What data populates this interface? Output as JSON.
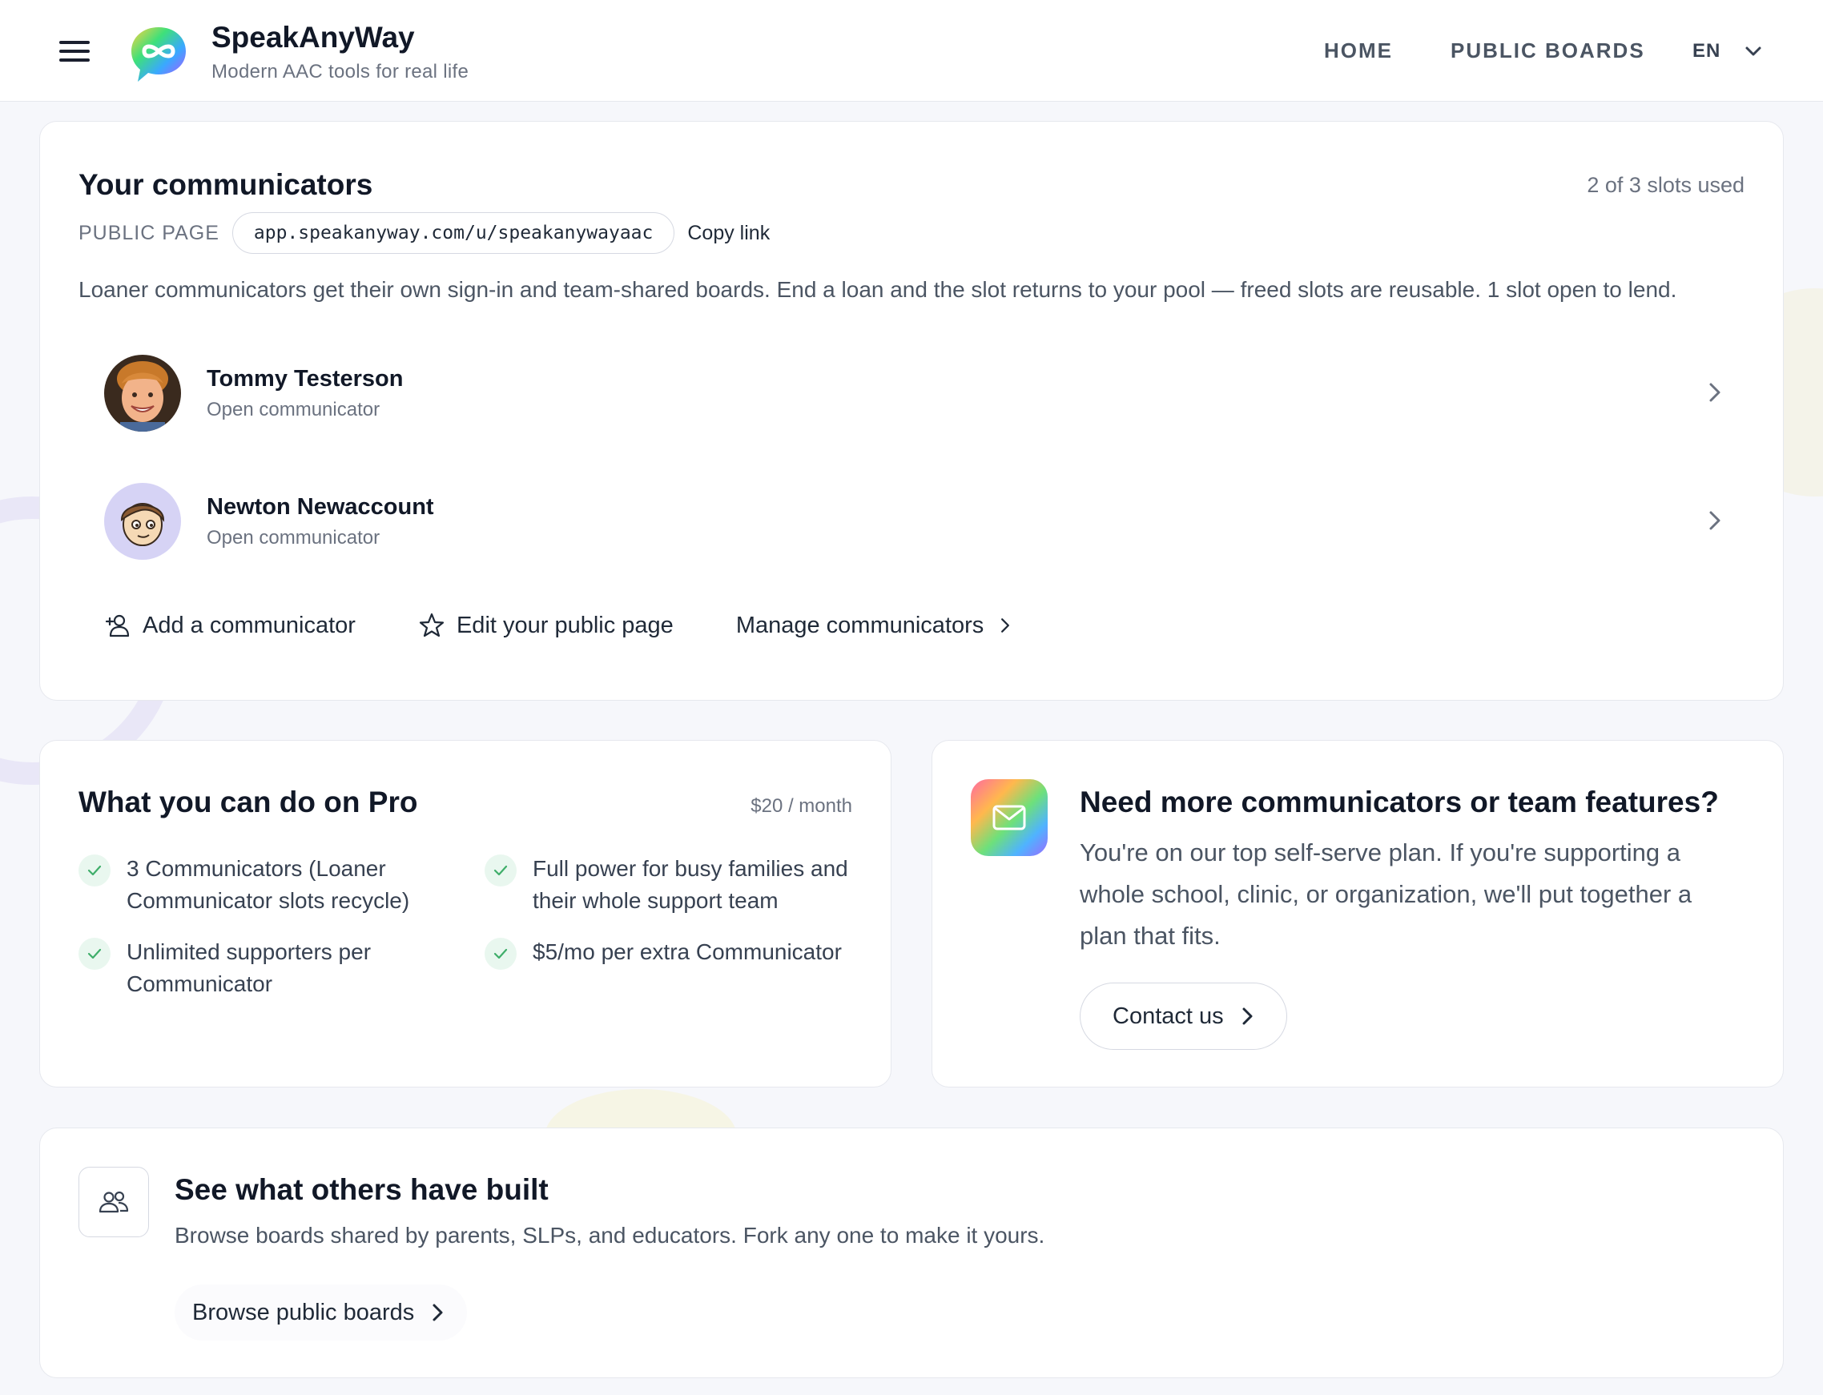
{
  "header": {
    "brand_name": "SpeakAnyWay",
    "brand_tagline": "Modern AAC tools for real life",
    "nav": {
      "home": "HOME",
      "public_boards": "PUBLIC BOARDS"
    },
    "language": "EN"
  },
  "communicators": {
    "title": "Your communicators",
    "slots_used": "2 of 3 slots used",
    "public_page_label": "PUBLIC PAGE",
    "public_url": "app.speakanyway.com/u/speakanywayaac",
    "copy_link": "Copy link",
    "description": "Loaner communicators get their own sign-in and team-shared boards. End a loan and the slot returns to your pool — freed slots are reusable. 1 slot open to lend.",
    "items": [
      {
        "name": "Tommy Testerson",
        "status": "Open communicator"
      },
      {
        "name": "Newton Newaccount",
        "status": "Open communicator"
      }
    ],
    "actions": {
      "add": "Add a communicator",
      "edit_public": "Edit your public page",
      "manage": "Manage communicators"
    }
  },
  "pro": {
    "title": "What you can do on Pro",
    "price": "$20 / month",
    "features": [
      "3 Communicators (Loaner Communicator slots recycle)",
      "Full power for busy families and their whole support team",
      "Unlimited supporters per Communicator",
      "$5/mo per extra Communicator"
    ]
  },
  "need_more": {
    "title": "Need more communicators or team features?",
    "body": "You're on our top self-serve plan. If you're supporting a whole school, clinic, or organization, we'll put together a plan that fits.",
    "cta": "Contact us"
  },
  "see_others": {
    "title": "See what others have built",
    "body": "Browse boards shared by parents, SLPs, and educators. Fork any one to make it yours.",
    "cta": "Browse public boards"
  },
  "colors": {
    "accent": "#1a1f2e",
    "check_bg": "#e9f7ef",
    "check_mark": "#3fae6a",
    "muted_text": "#6b7280"
  }
}
